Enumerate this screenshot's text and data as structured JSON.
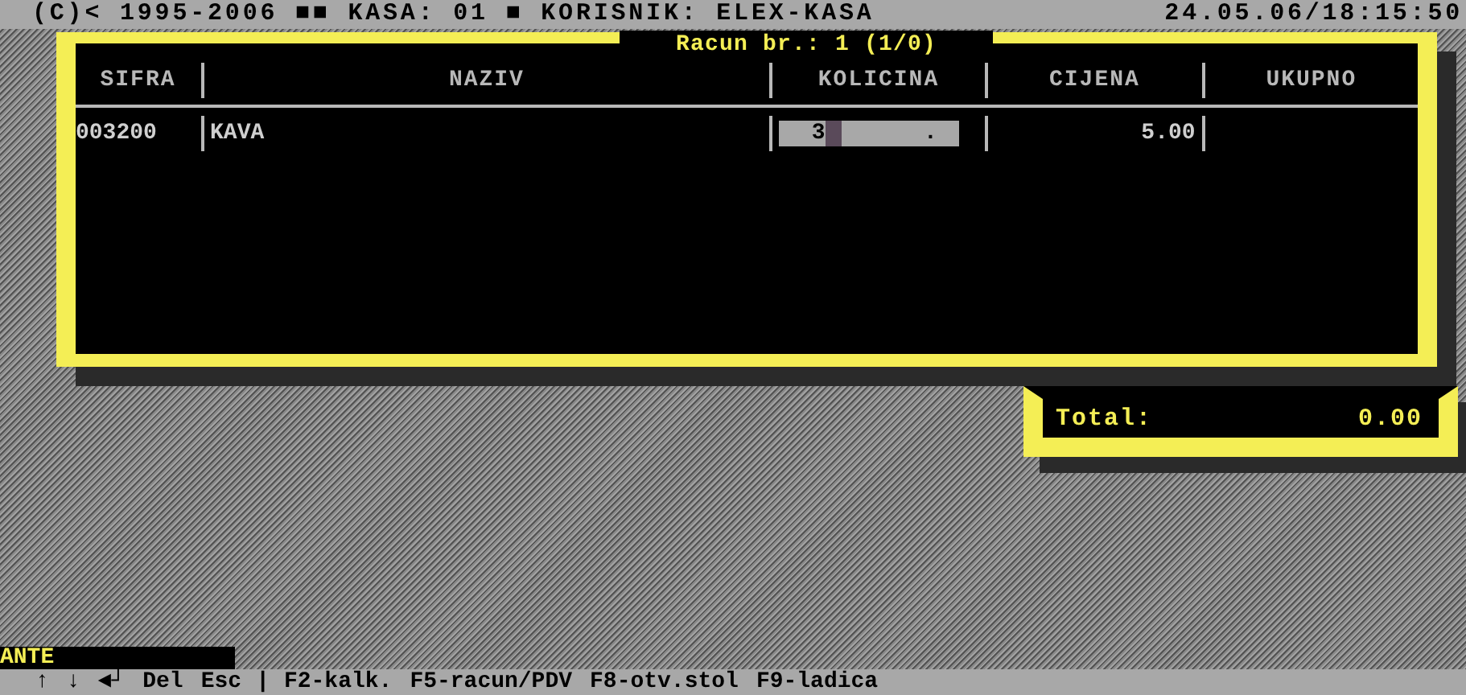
{
  "top_bar": {
    "left": "(C)< 1995-2006 ■■ KASA: 01 ■ KORISNIK: ELEX-KASA",
    "right": "24.05.06/18:15:50"
  },
  "receipt": {
    "title": "Racun br.: 1 (1/0)",
    "columns": [
      "SIFRA",
      "NAZIV",
      "KOLICINA",
      "CIJENA",
      "UKUPNO"
    ],
    "rows": [
      {
        "cells": [
          {
            "kind": "text",
            "text": "003200"
          },
          {
            "kind": "text",
            "text": "KAVA"
          },
          {
            "kind": "input",
            "value": "3",
            "suffix": "."
          },
          {
            "kind": "number",
            "text": "5.00"
          }
        ]
      }
    ]
  },
  "total": {
    "label": "Total:",
    "value": "0.00"
  },
  "user": "ANTE",
  "keys": [
    {
      "kind": "key",
      "text": "↑"
    },
    {
      "kind": "key",
      "text": "↓"
    },
    {
      "kind": "key",
      "text": "◄┘"
    },
    {
      "kind": "key",
      "text": "Del"
    },
    {
      "kind": "key",
      "text": "Esc"
    },
    {
      "kind": "separator",
      "text": "|"
    },
    {
      "kind": "key",
      "text": "F2-kalk."
    },
    {
      "kind": "key",
      "text": "F5-racun/PDV"
    },
    {
      "kind": "key",
      "text": "F8-otv.stol"
    },
    {
      "kind": "key",
      "text": "F9-ladica"
    }
  ]
}
